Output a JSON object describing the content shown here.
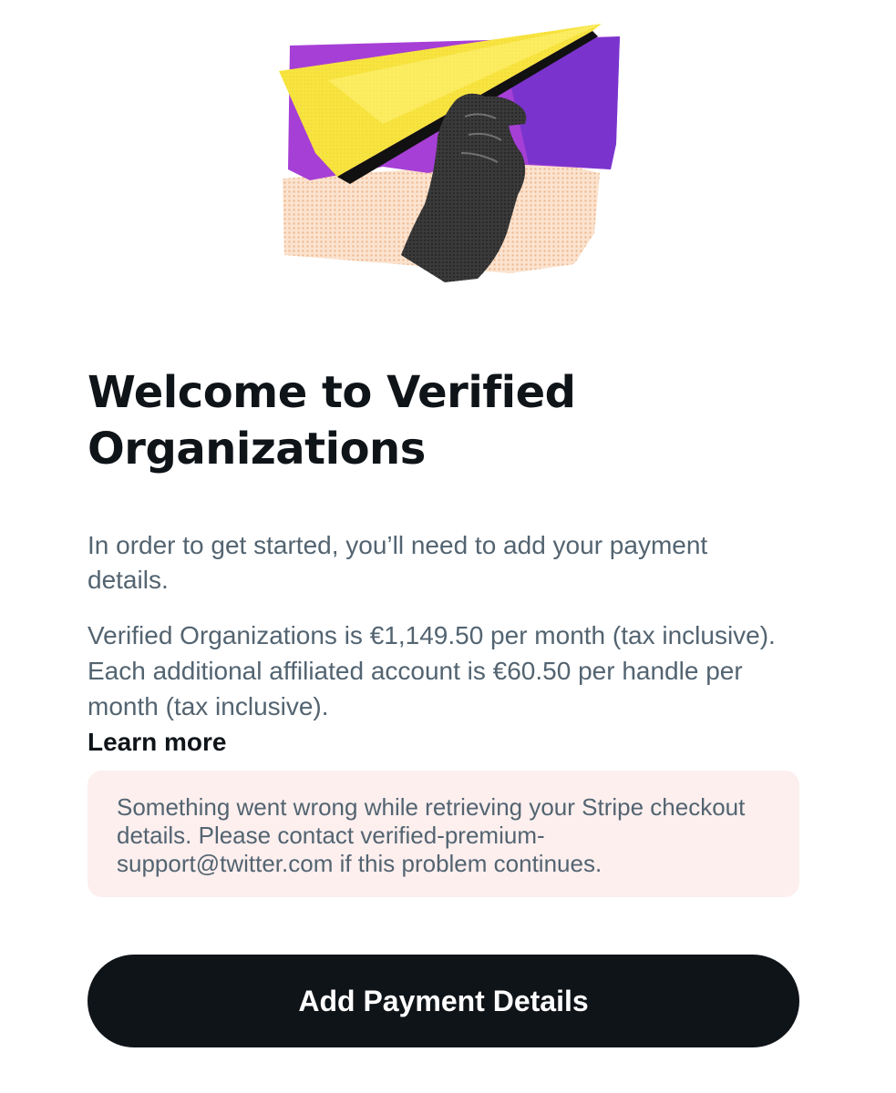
{
  "hero": {
    "illustration": "paper-plane-hand-illustration",
    "colors": {
      "purple": "#a63fd6",
      "yellow": "#f8e440",
      "peach": "#f5d2b5",
      "hand": "#3a3a3a"
    }
  },
  "welcome": {
    "title": "Welcome to Verified Organizations",
    "intro": "In order to get started, you’ll need to add your payment details.",
    "pricing": "Verified Organizations is €1,149.50 per month (tax inclusive). Each additional affiliated account is €60.50 per handle per month (tax inclusive).",
    "learn_more": "Learn more"
  },
  "error": {
    "message": "Something went wrong while retrieving your Stripe checkout details. Please contact verified-premium-support@twitter.com if this problem continues.",
    "background": "#fcefee"
  },
  "cta": {
    "label": "Add Payment Details",
    "background": "#0f1419"
  }
}
